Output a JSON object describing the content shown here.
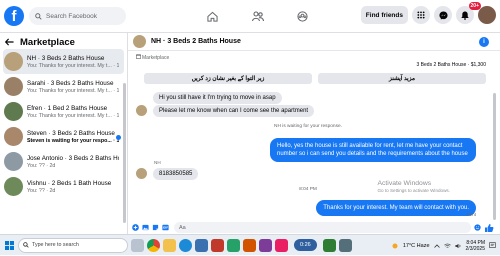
{
  "topbar": {
    "logo": "f",
    "search_placeholder": "Search Facebook",
    "find_friends": "Find friends",
    "notif_count": "20+"
  },
  "sidebar": {
    "title": "Marketplace",
    "conversations": [
      {
        "name": "NH · 3 Beds 2 Baths House",
        "preview": "You: Thanks for your interest. My t... · 1m",
        "unread": false,
        "active": true
      },
      {
        "name": "Sarahi · 3 Beds 2 Baths House",
        "preview": "You: Thanks for your interest. My t... · 1m",
        "unread": false,
        "active": false
      },
      {
        "name": "Efren · 1 Bed 2 Baths House",
        "preview": "You: Thanks for your interest. My t... · 1m",
        "unread": false,
        "active": false
      },
      {
        "name": "Steven · 3 Beds 2 Baths House",
        "preview": "Steven is waiting for your respo... · 1m",
        "unread": true,
        "active": false
      },
      {
        "name": "Jose Antonio · 3 Beds 2 Baths House",
        "preview": "You: ?? · 2d",
        "unread": false,
        "active": false
      },
      {
        "name": "Vishnu · 2 Beds 1 Bath House",
        "preview": "You: ?? · 2d",
        "unread": false,
        "active": false
      }
    ]
  },
  "chat": {
    "title": "NH · 3 Beds 2 Baths House",
    "listing_label": "Marketplace",
    "listing_title": "3 Beds 2 Baths House · $1,300",
    "quick_replies": [
      "زیر التوا کے بغیر نشان زد کریں",
      "مزید آپشنز"
    ],
    "messages": {
      "in1": "Hi you still have it I'm trying to move in asap",
      "in2": "Please let me know when can I come see the apartment",
      "system": "NH is waiting for your response.",
      "out1": "Hello, yes the house is still available for rent, let me have your contact number so i can send you details and the requirements about the house",
      "sender2": "NH",
      "in3": "8183850585",
      "timestamp": "8:04 PM",
      "out2": "Thanks for your interest. My team will contact with you.",
      "seen": "Sent"
    },
    "input_placeholder": "Aa"
  },
  "watermark": {
    "title": "Activate Windows",
    "subtitle": "Go to Settings to activate Windows."
  },
  "taskbar": {
    "search_placeholder": "Type here to search",
    "pill_text": "0:26",
    "weather": "17°C Haze",
    "time": "8:04 PM",
    "date": "2/3/2025"
  },
  "colors": {
    "brand": "#1877f2",
    "bubble_in": "#e4e6eb",
    "unread_dot": "#1877f2"
  }
}
